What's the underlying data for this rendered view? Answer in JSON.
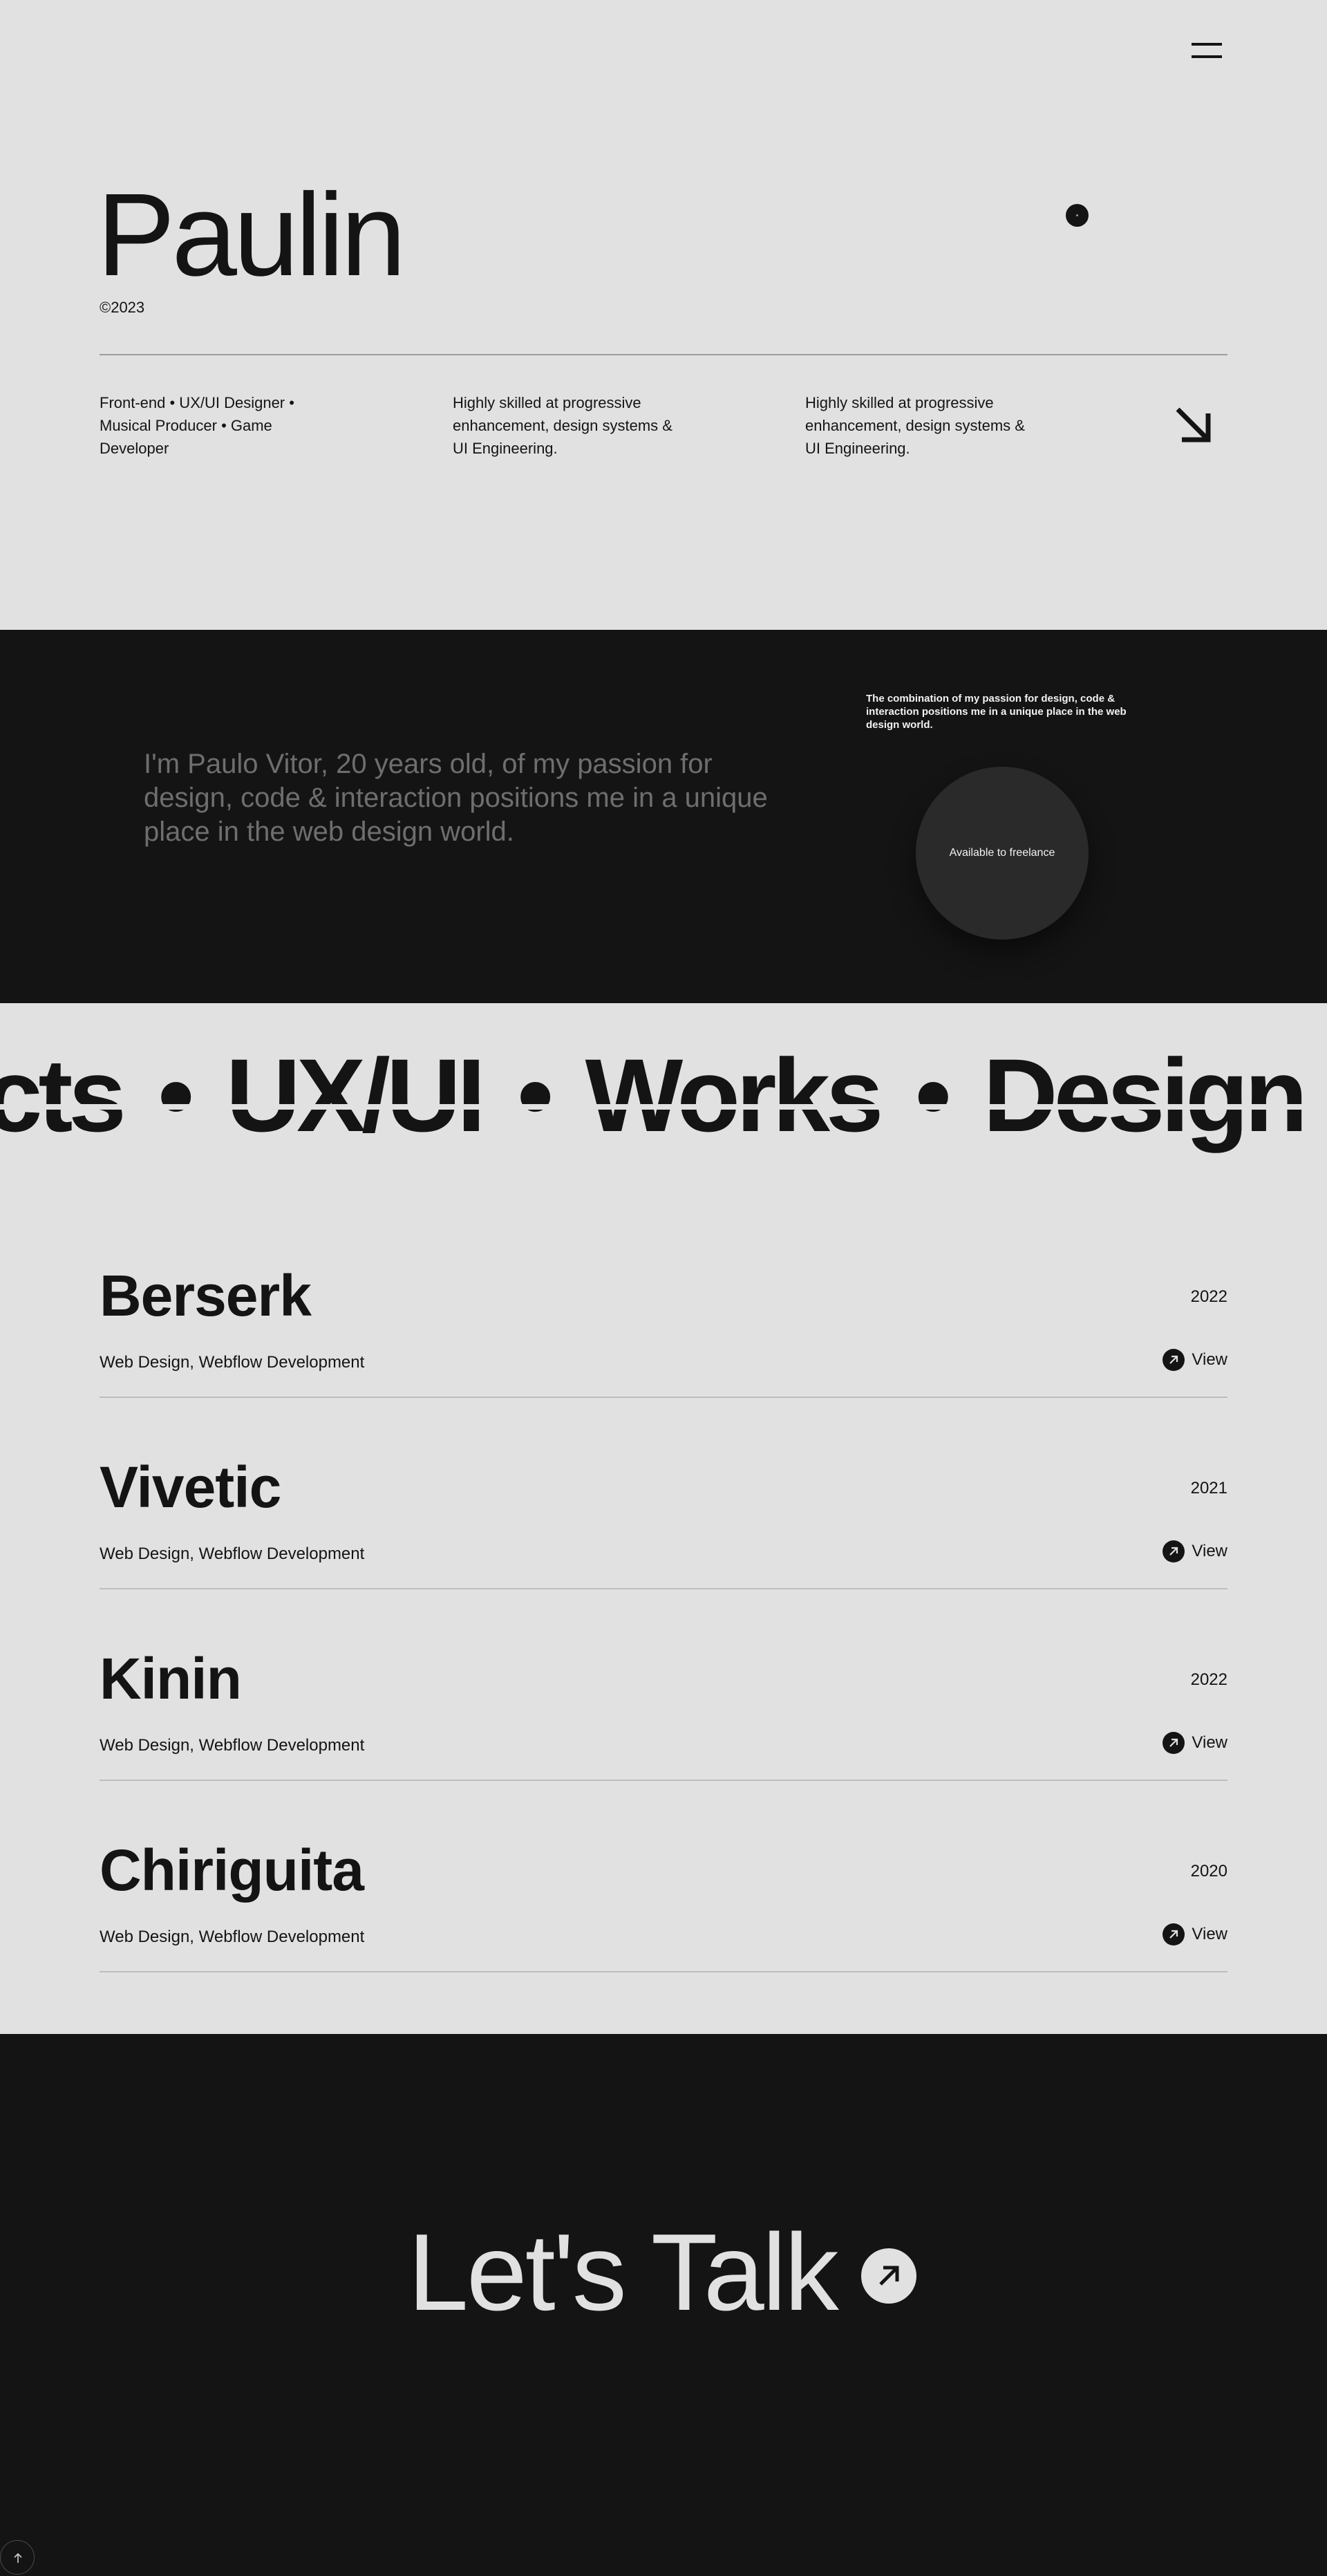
{
  "header": {
    "menu_icon": "menu-icon",
    "brand": "Paulin",
    "copyright": "©2023",
    "indicator_icon": "dot-icon"
  },
  "hero": {
    "columns": [
      "Front-end • UX/UI Designer • Musical Producer • Game Developer",
      "Highly skilled at progressive enhancement, design systems & UI Engineering.",
      "Highly skilled at progressive enhancement, design systems & UI Engineering."
    ],
    "arrow_icon": "arrow-down-right-icon"
  },
  "about": {
    "text": "I'm Paulo Vitor, 20 years old, of my passion for design, code & interaction positions me in a unique place in the web design world.",
    "side_note": "The combination of my passion for design, code & interaction positions me in a unique place in the web design world.",
    "freelance_label": "Available to freelance"
  },
  "marquee": {
    "words": [
      "cts",
      "UX/UI",
      "Works",
      "Design"
    ],
    "separator": "•"
  },
  "projects": [
    {
      "title": "Berserk",
      "year": "2022",
      "tags": "Web Design, Webflow Development",
      "view_label": "View"
    },
    {
      "title": "Vivetic",
      "year": "2021",
      "tags": "Web Design, Webflow Development",
      "view_label": "View"
    },
    {
      "title": "Kinin",
      "year": "2022",
      "tags": "Web Design, Webflow Development",
      "view_label": "View"
    },
    {
      "title": "Chiriguita",
      "year": "2020",
      "tags": "Web Design, Webflow Development",
      "view_label": "View"
    }
  ],
  "footer": {
    "cta": "Let's Talk",
    "cta_icon": "arrow-up-right-icon",
    "back_to_top_icon": "arrow-up-icon"
  },
  "colors": {
    "light_bg": "#e1e1e1",
    "dark_bg": "#141414",
    "text_dark": "#141414",
    "muted_text": "#6e6e6e"
  }
}
